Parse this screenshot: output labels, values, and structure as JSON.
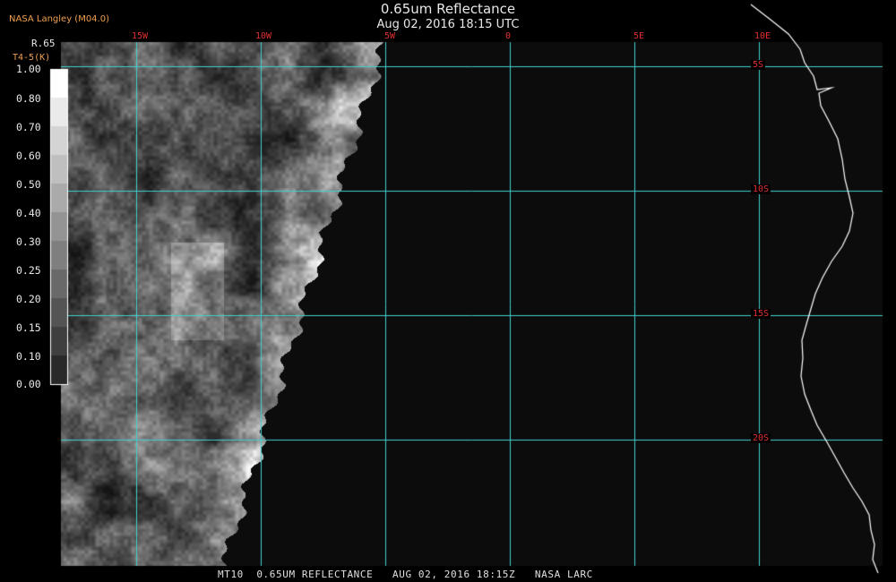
{
  "header": {
    "title": "0.65um Reflectance",
    "subtitle": "Aug 02, 2016 18:15 UTC",
    "credit": "NASA Langley (M04.0)"
  },
  "footer": {
    "text": "MT10  0.65UM REFLECTANCE   AUG 02, 2016 18:15Z   NASA LARC"
  },
  "map": {
    "longitude_labels": [
      "15W",
      "10W",
      "5W",
      "0",
      "5E",
      "10E"
    ],
    "latitude_labels": [
      "5S",
      "10S",
      "15S",
      "20S"
    ],
    "colors": {
      "grid": "#40d0d0",
      "labels": "#e03030",
      "coast": "#ffffff",
      "background": "#0c0c0c"
    }
  },
  "colorbar": {
    "label": "R.65",
    "label2": "T4-5(K)",
    "ticks": [
      "1.00",
      "0.80",
      "0.70",
      "0.60",
      "0.50",
      "0.40",
      "0.30",
      "0.25",
      "0.20",
      "0.15",
      "0.10",
      "0.00"
    ]
  }
}
